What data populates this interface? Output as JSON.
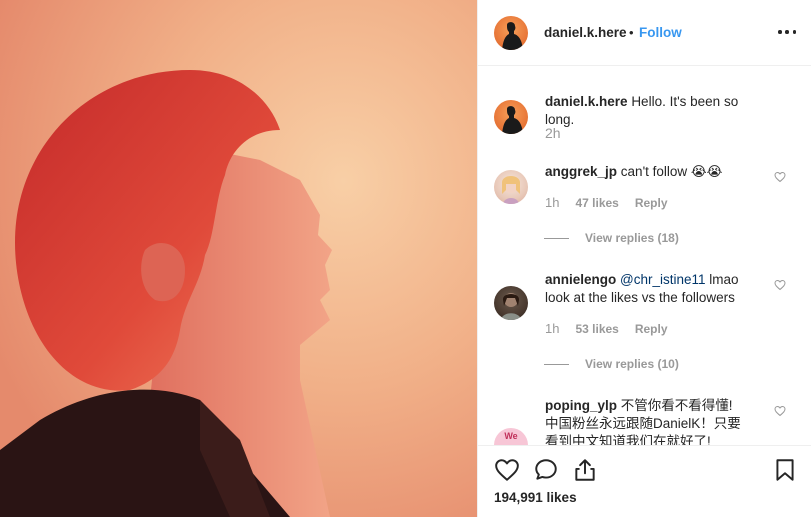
{
  "post": {
    "username": "daniel.k.here",
    "separator": "•",
    "follow_label": "Follow",
    "caption_username": "daniel.k.here",
    "caption_text": "Hello. It's been so long.",
    "caption_time": "2h",
    "likes_label": "194,991 likes"
  },
  "comments": [
    {
      "username": "anggrek_jp",
      "text": "can't follow 😭😭",
      "time": "1h",
      "likes": "47 likes",
      "reply": "Reply",
      "view_replies": "View replies (18)"
    },
    {
      "username": "annielengo",
      "mention": "@chr_istine11",
      "text_line1_rest": " lmao",
      "text_line2": "look at the likes vs the followers",
      "time": "1h",
      "likes": "53 likes",
      "reply": "Reply",
      "view_replies": "View replies (10)"
    },
    {
      "username": "poping_ylp",
      "text_line1": "不管你看不看得懂!",
      "text_line2": "中国粉丝永远跟随DanielK！只要",
      "text_line3": "看到中文知道我们在就好了!",
      "avatar_text": "We"
    }
  ],
  "colors": {
    "link": "#3897f0",
    "mention": "#003569",
    "muted": "#999999",
    "text": "#262626"
  }
}
